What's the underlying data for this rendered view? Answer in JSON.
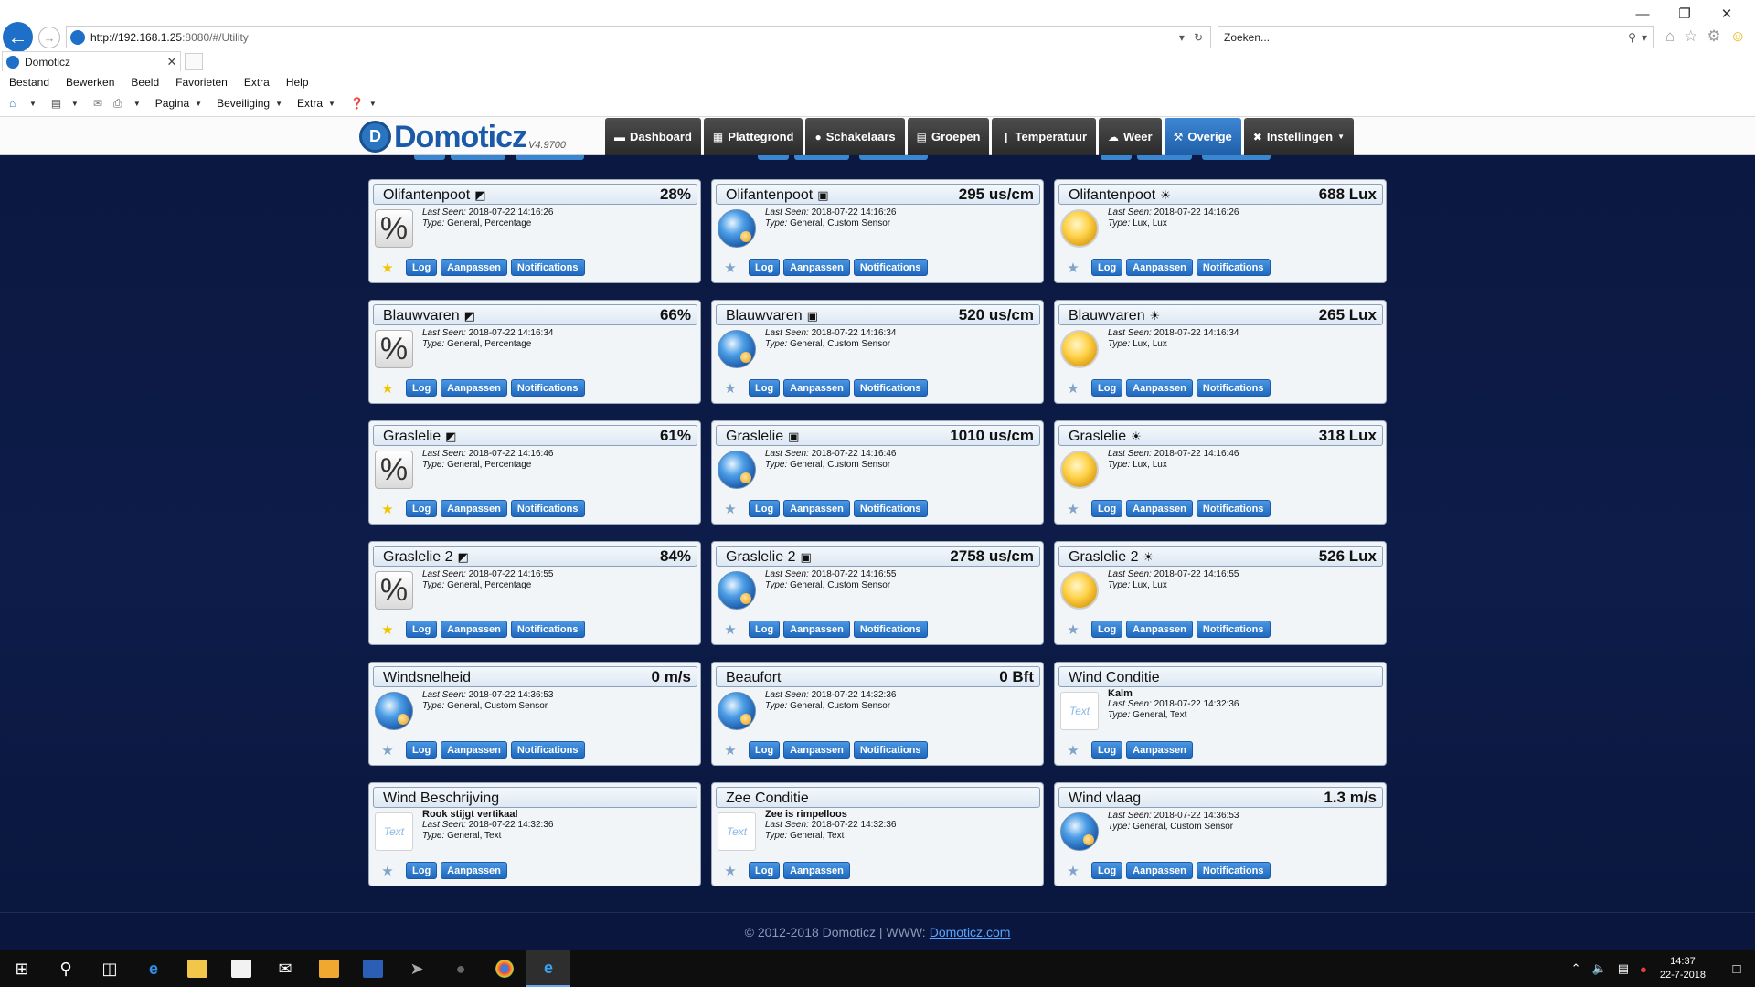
{
  "browser": {
    "url_host": "http://192.168.1.25",
    "url_rest": ":8080/#/Utility",
    "search_placeholder": "Zoeken...",
    "tab_title": "Domoticz",
    "menu": [
      "Bestand",
      "Bewerken",
      "Beeld",
      "Favorieten",
      "Extra",
      "Help"
    ],
    "commands": [
      "Pagina",
      "Beveiliging",
      "Extra"
    ]
  },
  "app": {
    "logo_text": "Domoticz",
    "version": "V4.9700",
    "nav": [
      {
        "label": "Dashboard",
        "icon": "monitor-icon"
      },
      {
        "label": "Plattegrond",
        "icon": "floorplan-icon"
      },
      {
        "label": "Schakelaars",
        "icon": "bulb-icon"
      },
      {
        "label": "Groepen",
        "icon": "groups-icon"
      },
      {
        "label": "Temperatuur",
        "icon": "thermometer-icon"
      },
      {
        "label": "Weer",
        "icon": "weather-icon"
      },
      {
        "label": "Overige",
        "icon": "utility-icon",
        "active": true
      },
      {
        "label": "Instellingen",
        "icon": "settings-icon",
        "caret": true
      }
    ]
  },
  "labels": {
    "last_seen": "Last Seen:",
    "type": "Type:",
    "log": "Log",
    "edit": "Aanpassen",
    "notifications": "Notifications"
  },
  "cards": [
    {
      "name": "Olifantenpoot",
      "sym": "◩",
      "value": "28%",
      "last_seen": "2018-07-22 14:16:26",
      "type": "General, Percentage",
      "icon": "percentage",
      "fav": true,
      "notif": true
    },
    {
      "name": "Olifantenpoot",
      "sym": "▣",
      "value": "295 us/cm",
      "last_seen": "2018-07-22 14:16:26",
      "type": "General, Custom Sensor",
      "icon": "globe",
      "fav": false,
      "notif": true
    },
    {
      "name": "Olifantenpoot",
      "sym": "☀",
      "value": "688 Lux",
      "last_seen": "2018-07-22 14:16:26",
      "type": "Lux, Lux",
      "icon": "lux",
      "fav": false,
      "notif": true
    },
    {
      "name": "Blauwvaren",
      "sym": "◩",
      "value": "66%",
      "last_seen": "2018-07-22 14:16:34",
      "type": "General, Percentage",
      "icon": "percentage",
      "fav": true,
      "notif": true
    },
    {
      "name": "Blauwvaren",
      "sym": "▣",
      "value": "520 us/cm",
      "last_seen": "2018-07-22 14:16:34",
      "type": "General, Custom Sensor",
      "icon": "globe",
      "fav": false,
      "notif": true
    },
    {
      "name": "Blauwvaren",
      "sym": "☀",
      "value": "265 Lux",
      "last_seen": "2018-07-22 14:16:34",
      "type": "Lux, Lux",
      "icon": "lux",
      "fav": false,
      "notif": true
    },
    {
      "name": "Graslelie",
      "sym": "◩",
      "value": "61%",
      "last_seen": "2018-07-22 14:16:46",
      "type": "General, Percentage",
      "icon": "percentage",
      "fav": true,
      "notif": true
    },
    {
      "name": "Graslelie",
      "sym": "▣",
      "value": "1010 us/cm",
      "last_seen": "2018-07-22 14:16:46",
      "type": "General, Custom Sensor",
      "icon": "globe",
      "fav": false,
      "notif": true
    },
    {
      "name": "Graslelie",
      "sym": "☀",
      "value": "318 Lux",
      "last_seen": "2018-07-22 14:16:46",
      "type": "Lux, Lux",
      "icon": "lux",
      "fav": false,
      "notif": true
    },
    {
      "name": "Graslelie 2",
      "sym": "◩",
      "value": "84%",
      "last_seen": "2018-07-22 14:16:55",
      "type": "General, Percentage",
      "icon": "percentage",
      "fav": true,
      "notif": true
    },
    {
      "name": "Graslelie 2",
      "sym": "▣",
      "value": "2758 us/cm",
      "last_seen": "2018-07-22 14:16:55",
      "type": "General, Custom Sensor",
      "icon": "globe",
      "fav": false,
      "notif": true
    },
    {
      "name": "Graslelie 2",
      "sym": "☀",
      "value": "526 Lux",
      "last_seen": "2018-07-22 14:16:55",
      "type": "Lux, Lux",
      "icon": "lux",
      "fav": false,
      "notif": true
    },
    {
      "name": "Windsnelheid",
      "sym": "",
      "value": "0 m/s",
      "last_seen": "2018-07-22 14:36:53",
      "type": "General, Custom Sensor",
      "icon": "globe",
      "fav": false,
      "notif": true
    },
    {
      "name": "Beaufort",
      "sym": "",
      "value": "0 Bft",
      "last_seen": "2018-07-22 14:32:36",
      "type": "General, Custom Sensor",
      "icon": "globe",
      "fav": false,
      "notif": true
    },
    {
      "name": "Wind Conditie",
      "sym": "",
      "value": "",
      "desc": "Kalm",
      "last_seen": "2018-07-22 14:32:36",
      "type": "General, Text",
      "icon": "text",
      "fav": false,
      "notif": false
    },
    {
      "name": "Wind Beschrijving",
      "sym": "",
      "value": "",
      "desc": "Rook stijgt vertikaal",
      "last_seen": "2018-07-22 14:32:36",
      "type": "General, Text",
      "icon": "text",
      "fav": false,
      "notif": false
    },
    {
      "name": "Zee Conditie",
      "sym": "",
      "value": "",
      "desc": "Zee is rimpelloos",
      "last_seen": "2018-07-22 14:32:36",
      "type": "General, Text",
      "icon": "text",
      "fav": false,
      "notif": false
    },
    {
      "name": "Wind vlaag",
      "sym": "",
      "value": "1.3 m/s",
      "last_seen": "2018-07-22 14:36:53",
      "type": "General, Custom Sensor",
      "icon": "globe",
      "fav": false,
      "notif": true
    }
  ],
  "footer": {
    "copyright": "© 2012-2018 Domoticz | WWW:",
    "link": "Domoticz.com"
  },
  "taskbar": {
    "time": "14:37",
    "date": "22-7-2018"
  }
}
